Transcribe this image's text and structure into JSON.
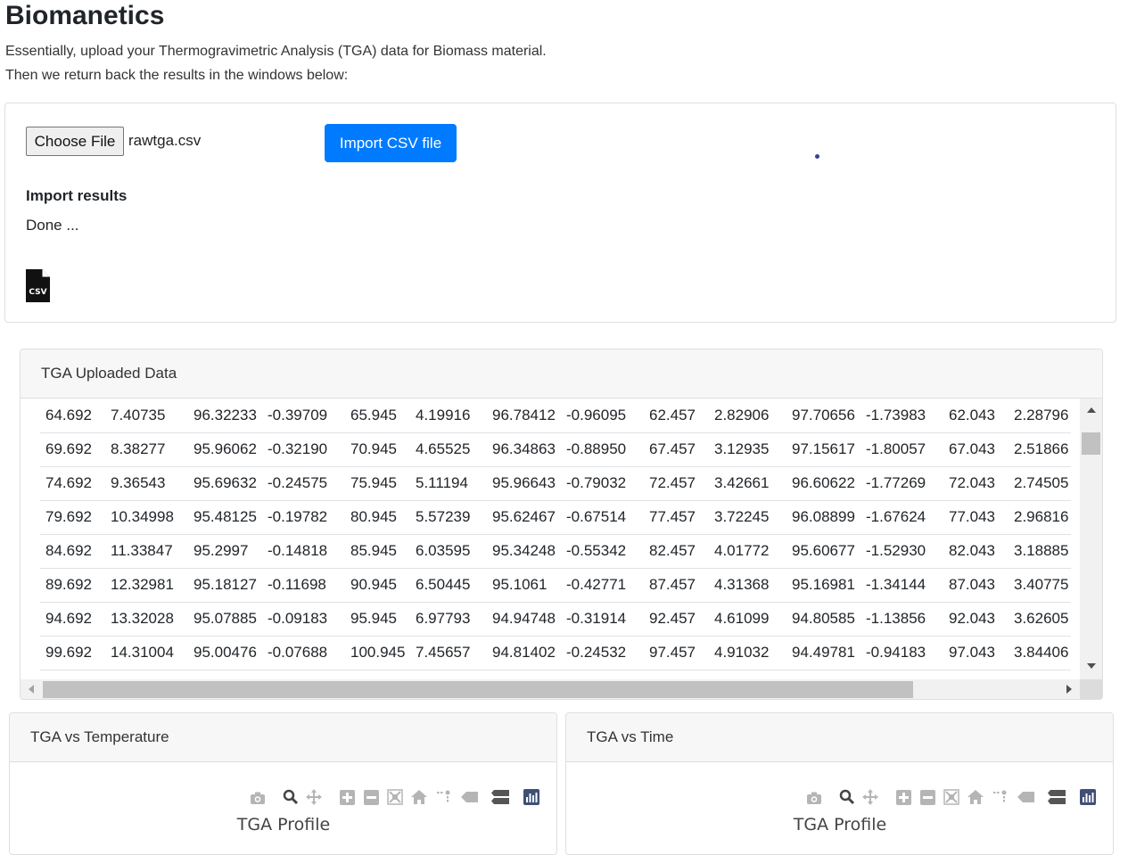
{
  "page": {
    "title": "Biomanetics",
    "intro_line1": "Essentially, upload your Thermogravimetric Analysis (TGA) data for Biomass material.",
    "intro_line2": "Then we return back the results in the windows below:"
  },
  "upload": {
    "choose_file_label": "Choose File",
    "file_name": "rawtga.csv",
    "import_button_label": "Import CSV file",
    "results_heading": "Import results",
    "results_status": "Done ...",
    "csv_icon_label": "CSV"
  },
  "data_table": {
    "header": "TGA Uploaded Data",
    "rows": [
      [
        "64.692",
        "7.40735",
        "96.32233",
        "-0.39709",
        "65.945",
        "4.19916",
        "96.78412",
        "-0.96095",
        "62.457",
        "2.82906",
        "97.70656",
        "-1.73983",
        "62.043",
        "2.28796"
      ],
      [
        "69.692",
        "8.38277",
        "95.96062",
        "-0.32190",
        "70.945",
        "4.65525",
        "96.34863",
        "-0.88950",
        "67.457",
        "3.12935",
        "97.15617",
        "-1.80057",
        "67.043",
        "2.51866"
      ],
      [
        "74.692",
        "9.36543",
        "95.69632",
        "-0.24575",
        "75.945",
        "5.11194",
        "95.96643",
        "-0.79032",
        "72.457",
        "3.42661",
        "96.60622",
        "-1.77269",
        "72.043",
        "2.74505"
      ],
      [
        "79.692",
        "10.34998",
        "95.48125",
        "-0.19782",
        "80.945",
        "5.57239",
        "95.62467",
        "-0.67514",
        "77.457",
        "3.72245",
        "96.08899",
        "-1.67624",
        "77.043",
        "2.96816"
      ],
      [
        "84.692",
        "11.33847",
        "95.2997",
        "-0.14818",
        "85.945",
        "6.03595",
        "95.34248",
        "-0.55342",
        "82.457",
        "4.01772",
        "95.60677",
        "-1.52930",
        "82.043",
        "3.18885"
      ],
      [
        "89.692",
        "12.32981",
        "95.18127",
        "-0.11698",
        "90.945",
        "6.50445",
        "95.1061",
        "-0.42771",
        "87.457",
        "4.31368",
        "95.16981",
        "-1.34144",
        "87.043",
        "3.40775"
      ],
      [
        "94.692",
        "13.32028",
        "95.07885",
        "-0.09183",
        "95.945",
        "6.97793",
        "94.94748",
        "-0.31914",
        "92.457",
        "4.61099",
        "94.80585",
        "-1.13856",
        "92.043",
        "3.62605"
      ],
      [
        "99.692",
        "14.31004",
        "95.00476",
        "-0.07688",
        "100.945",
        "7.45657",
        "94.81402",
        "-0.24532",
        "97.457",
        "4.91032",
        "94.49781",
        "-0.94183",
        "97.043",
        "3.84406"
      ]
    ]
  },
  "charts": {
    "left": {
      "header": "TGA vs Temperature",
      "plot_title": "TGA Profile"
    },
    "right": {
      "header": "TGA vs Time",
      "plot_title": "TGA Profile"
    }
  },
  "modebar_icons": [
    "camera-icon",
    "zoom-icon",
    "pan-icon",
    "zoom-in-icon",
    "zoom-out-icon",
    "autoscale-icon",
    "home-icon",
    "spike-lines-icon",
    "hover-closest-icon",
    "hover-compare-icon",
    "plotly-logo-icon"
  ],
  "colors": {
    "primary": "#007bff",
    "plotly_logo": "#3f4f75"
  }
}
